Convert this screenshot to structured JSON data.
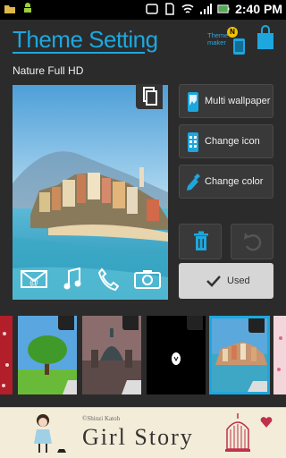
{
  "status_bar": {
    "time": "2:40 PM"
  },
  "header": {
    "title": "Theme Setting",
    "maker_label": "Theme maker",
    "maker_badge": "N"
  },
  "theme": {
    "name": "Nature Full HD"
  },
  "actions": {
    "multi_wallpaper": "Multi wallpaper",
    "change_icon": "Change icon",
    "change_color": "Change color",
    "used": "Used"
  },
  "thumbnails": [
    {
      "name": "red-pattern"
    },
    {
      "name": "green-tree"
    },
    {
      "name": "cathedral"
    },
    {
      "name": "black-egg"
    },
    {
      "name": "coastal-town",
      "selected": true
    },
    {
      "name": "pink-pattern"
    }
  ],
  "ad": {
    "copyright": "©Shinzi Katoh",
    "title": "Girl Story"
  },
  "colors": {
    "accent": "#1ea7de",
    "background": "#2b2b2b"
  }
}
